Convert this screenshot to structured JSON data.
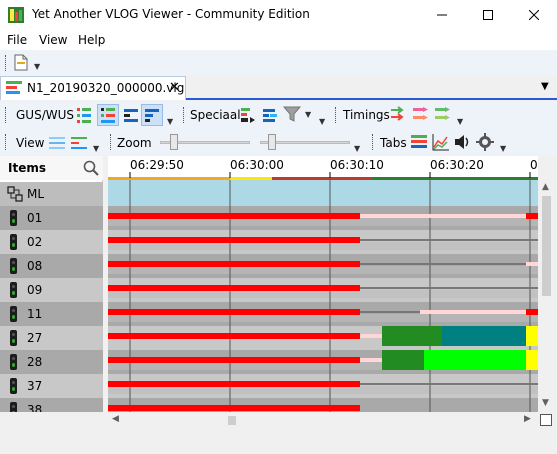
{
  "window": {
    "title": "Yet Another VLOG Viewer - Community Edition"
  },
  "menu": {
    "file": "File",
    "view": "View",
    "help": "Help"
  },
  "document_tab": {
    "label": "N1_20190320_000000.vlg",
    "close": "✕"
  },
  "toolbar": {
    "gus_label": "GUS/WUS",
    "speciaal_label": "Speciaal",
    "timings_label": "Timings",
    "view_label": "View",
    "zoom_label": "Zoom",
    "tabs_label": "Tabs"
  },
  "items_panel": {
    "header": "Items",
    "ml_label": "ML",
    "items": [
      "01",
      "02",
      "08",
      "09",
      "11",
      "27",
      "28",
      "37",
      "38"
    ]
  },
  "timeline": {
    "ticks": [
      "06:29:50",
      "06:30:00",
      "06:30:10",
      "06:30:20",
      "0"
    ]
  },
  "colors": {
    "red": "#ff0000",
    "dark_green": "#228b22",
    "teal": "#008080",
    "lime": "#00ff00",
    "yellow": "#ffff00",
    "pink": "#ffd7d7",
    "ml_bar": "#add8e6",
    "row_dark": "#a9a9a9",
    "row_light": "#c8c8c8"
  }
}
